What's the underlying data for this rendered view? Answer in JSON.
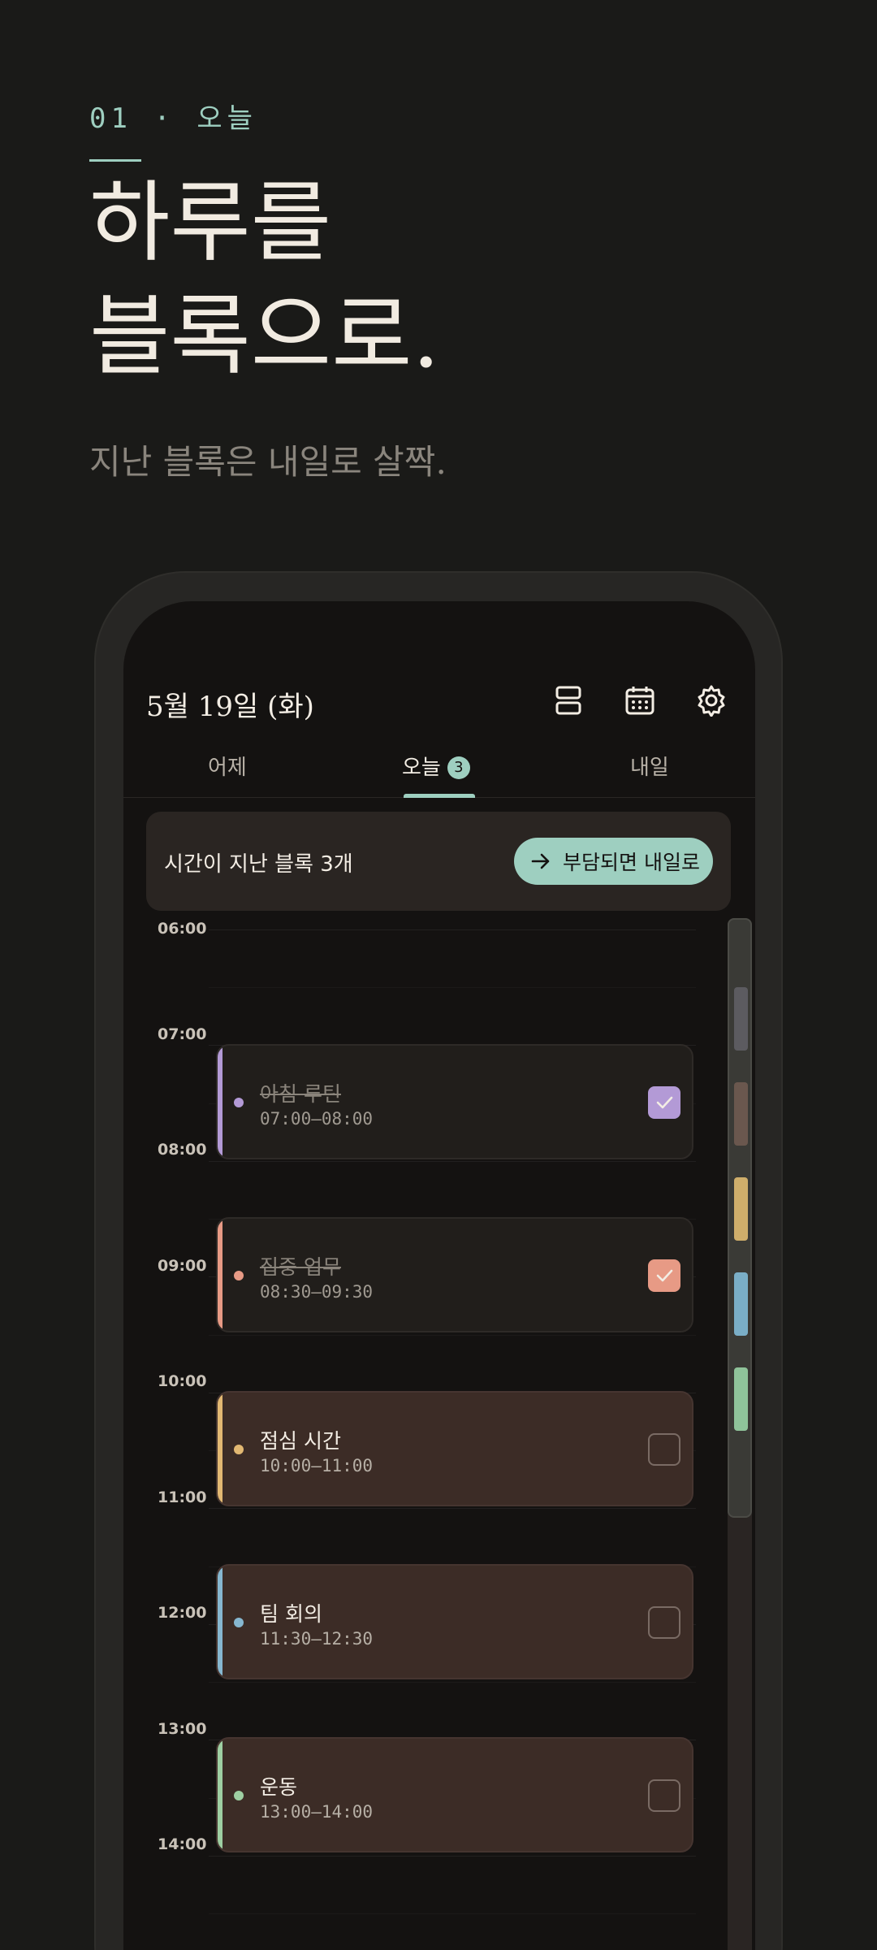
{
  "hero": {
    "eyebrow": "01 · 오늘",
    "headline_line1": "하루를",
    "headline_line2": "블록으로.",
    "subline": "지난 블록은 내일로 살짝."
  },
  "app": {
    "date": "5월 19일 (화)",
    "icons": [
      "list-icon",
      "calendar-icon",
      "gear-icon"
    ],
    "tabs": [
      {
        "label": "어제",
        "active": false
      },
      {
        "label": "오늘",
        "active": true,
        "badge": "3"
      },
      {
        "label": "내일",
        "active": false
      }
    ],
    "overdue": {
      "text": "시간이 지난 블록 3개",
      "button_label": "부담되면 내일로"
    },
    "hours": [
      "06:00",
      "07:00",
      "08:00",
      "09:00",
      "10:00",
      "11:00",
      "12:00",
      "13:00",
      "14:00"
    ],
    "blocks": [
      {
        "title": "아침 루틴",
        "time": "07:00–08:00",
        "done": true,
        "color": "#b39ad6"
      },
      {
        "title": "집중 업무",
        "time": "08:30–09:30",
        "done": true,
        "color": "#e79a85"
      },
      {
        "title": "점심 시간",
        "time": "10:00–11:00",
        "done": false,
        "color": "#e2b872"
      },
      {
        "title": "팀 회의",
        "time": "11:30–12:30",
        "done": false,
        "color": "#86b7d0"
      },
      {
        "title": "운동",
        "time": "13:00–14:00",
        "done": false,
        "color": "#9ecfa2"
      }
    ],
    "minimap_colors": [
      "#5c5b60",
      "#6a574e",
      "#cfae6b",
      "#7aaec7",
      "#8fc39a"
    ]
  },
  "colors": {
    "accent": "#9ecfc0",
    "background": "#1a1a18",
    "surface": "#141211"
  }
}
